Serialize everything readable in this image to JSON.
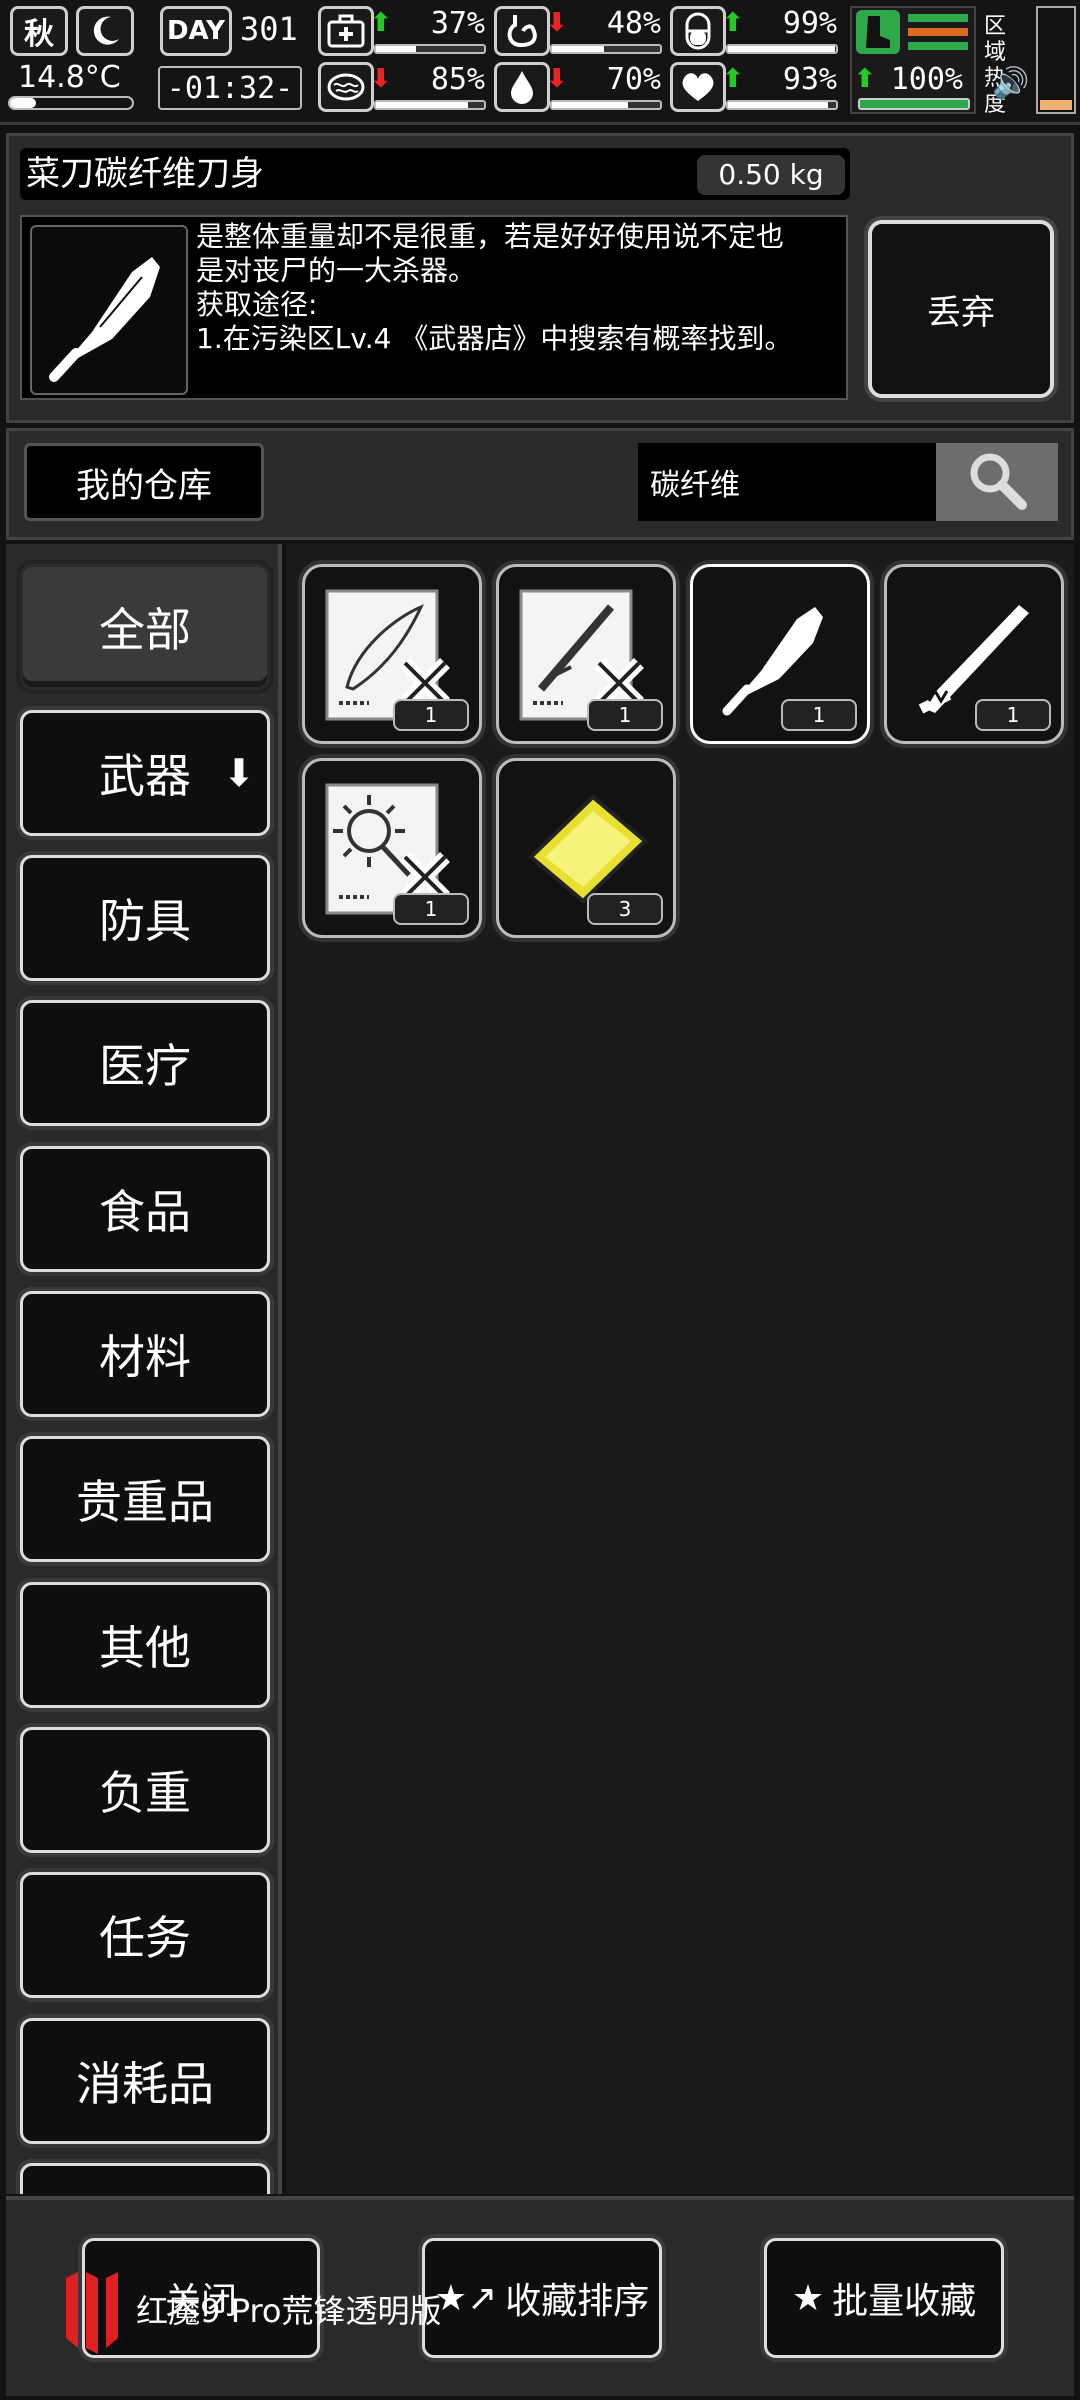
{
  "status": {
    "season": "秋",
    "day_label": "DAY",
    "day": "301",
    "temperature": "14.8°C",
    "time": "-01:32-",
    "stats": [
      {
        "name": "health",
        "percent": "37%",
        "trend": "up",
        "level": 0.37
      },
      {
        "name": "stomach",
        "percent": "48%",
        "trend": "down",
        "level": 0.48
      },
      {
        "name": "mood",
        "percent": "99%",
        "trend": "up",
        "level": 0.99
      },
      {
        "name": "brain",
        "percent": "85%",
        "trend": "down",
        "level": 0.85
      },
      {
        "name": "water",
        "percent": "70%",
        "trend": "down",
        "level": 0.7
      },
      {
        "name": "heart",
        "percent": "93%",
        "trend": "up",
        "level": 0.93
      }
    ],
    "stamina_percent": "100%",
    "stamina_trend": "up",
    "region_heat_label": "区域热度"
  },
  "item": {
    "name": "菜刀碳纤维刀身",
    "weight": "0.50 kg",
    "description_lines": [
      "是整体重量却不是很重，若是好好使用说不定也",
      "是对丧尸的一大杀器。",
      "获取途径:",
      "1.在污染区Lv.4 《武器店》中搜索有概率找到。"
    ],
    "drop_label": "丢弃",
    "icon": "cleaver-icon"
  },
  "search": {
    "warehouse_label": "我的仓库",
    "value": "碳纤维",
    "icon": "search-icon"
  },
  "categories": [
    {
      "label": "全部",
      "active": true
    },
    {
      "label": "武器",
      "active": false,
      "arrow": "⬇"
    },
    {
      "label": "防具",
      "active": false
    },
    {
      "label": "医疗",
      "active": false
    },
    {
      "label": "食品",
      "active": false
    },
    {
      "label": "材料",
      "active": false
    },
    {
      "label": "贵重品",
      "active": false
    },
    {
      "label": "其他",
      "active": false
    },
    {
      "label": "负重",
      "active": false
    },
    {
      "label": "任务",
      "active": false
    },
    {
      "label": "消耗品",
      "active": false
    }
  ],
  "grid_items": [
    {
      "icon": "leaf-blade-blueprint-icon",
      "count": "1"
    },
    {
      "icon": "rifle-blueprint-icon",
      "count": "1"
    },
    {
      "icon": "cleaver-icon",
      "count": "1",
      "selected": true
    },
    {
      "icon": "long-blade-icon",
      "count": "1"
    },
    {
      "icon": "mace-blueprint-icon",
      "count": "1"
    },
    {
      "icon": "gold-plate-icon",
      "count": "3"
    }
  ],
  "bottom": {
    "close_label": "关闭",
    "sort_label": "收藏排序",
    "batch_label": "批量收藏",
    "watermark": "红魔9 Pro荒锋透明版"
  },
  "colors": {
    "up": "#22cc22",
    "down": "#ee2222",
    "gold": "#e8e030",
    "stamina_green": "#2ea84a",
    "stamina_orange": "#e06a20"
  }
}
